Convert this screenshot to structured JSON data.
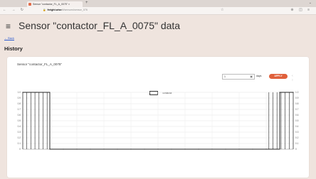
{
  "browser": {
    "tab_title": "Sensor \"contactor_FL_A_0075\" ×",
    "url_host": "freight.wise",
    "url_path": "/#/sensors/sensor_076",
    "colors": {
      "close": "#ff5f56",
      "min": "#ffbd2e",
      "max": "#27c93f"
    }
  },
  "page": {
    "title": "Sensor \"contactor_FL_A_0075\" data",
    "back_label": "← Back",
    "section_title": "History"
  },
  "card": {
    "title": "Sensor \"contactor_FL_A_0075\"",
    "input_value": "1",
    "unit": "days",
    "apply_label": "APPLY",
    "pager": "‹ ›"
  },
  "chart_data": {
    "type": "line",
    "series": [
      {
        "name": "contactor",
        "x": [
          0,
          0.5,
          1,
          1.5,
          2,
          2.5,
          3,
          3.5,
          4,
          4.5,
          5,
          5.5,
          6,
          6.5,
          7,
          7.5,
          8,
          8.5,
          9,
          9.5,
          10
        ],
        "values": [
          1,
          1,
          0,
          0,
          0,
          0,
          0,
          0,
          0,
          0,
          0,
          0,
          0,
          0,
          0,
          0,
          0,
          0,
          0,
          1,
          1
        ]
      }
    ],
    "yticks": [
      "0",
      "0.1",
      "0.2",
      "0.3",
      "0.4",
      "0.5",
      "0.6",
      "0.7",
      "0.8",
      "0.9",
      "1.0"
    ],
    "ylim": [
      0,
      1
    ],
    "grid": true,
    "legend": "top-center"
  }
}
